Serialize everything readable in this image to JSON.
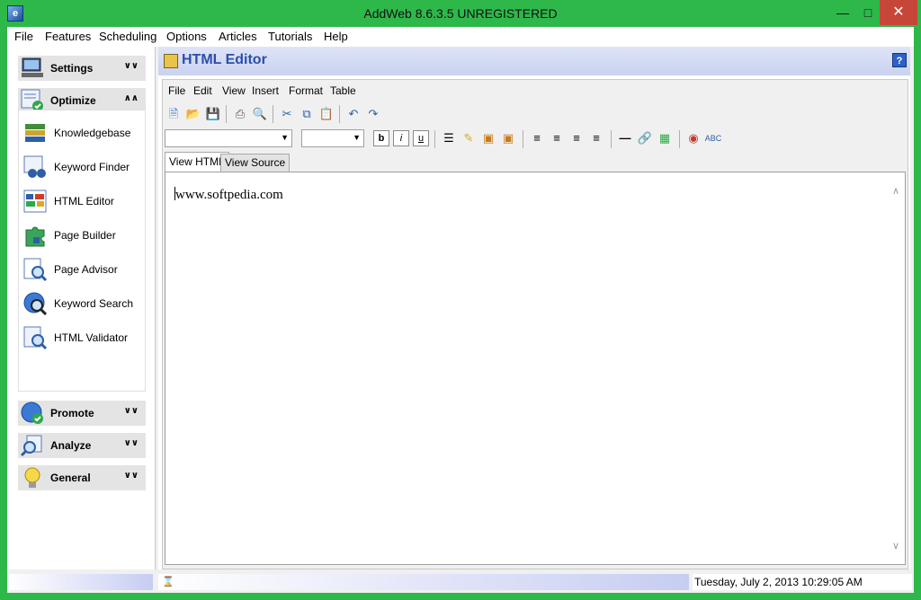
{
  "window": {
    "title": "AddWeb 8.6.3.5  UNREGISTERED",
    "app_icon": "addweb-logo-icon"
  },
  "menu": {
    "items": [
      "File",
      "Features",
      "Scheduling",
      "Options",
      "Articles",
      "Tutorials",
      "Help"
    ]
  },
  "sidebar": {
    "sections": [
      {
        "label": "Settings",
        "icon": "computer-icon",
        "state": "collapsed"
      },
      {
        "label": "Optimize",
        "icon": "optimize-check-icon",
        "state": "expanded"
      },
      {
        "label": "Promote",
        "icon": "globe-check-icon",
        "state": "collapsed"
      },
      {
        "label": "Analyze",
        "icon": "analyze-magnifier-icon",
        "state": "collapsed"
      },
      {
        "label": "General",
        "icon": "lightbulb-icon",
        "state": "collapsed"
      }
    ],
    "optimize_items": [
      {
        "label": "Knowledgebase",
        "icon": "books-icon"
      },
      {
        "label": "Keyword Finder",
        "icon": "binoculars-icon"
      },
      {
        "label": "HTML Editor",
        "icon": "html-editor-icon"
      },
      {
        "label": "Page Builder",
        "icon": "puzzle-icon"
      },
      {
        "label": "Page Advisor",
        "icon": "page-magnifier-icon"
      },
      {
        "label": "Keyword Search",
        "icon": "globe-magnifier-icon"
      },
      {
        "label": "HTML Validator",
        "icon": "validator-magnifier-icon"
      }
    ]
  },
  "panel": {
    "title": "HTML Editor",
    "help": "?"
  },
  "editor": {
    "menu": [
      "File",
      "Edit",
      "View",
      "Insert",
      "Format",
      "Table"
    ],
    "format_buttons": {
      "bold": "b",
      "italic": "i",
      "underline": "u"
    },
    "tabs": [
      "View HTML",
      "View Source"
    ],
    "active_tab": "View HTML",
    "content": "www.softpedia.com"
  },
  "status": {
    "datetime": "Tuesday, July 2, 2013 10:29:05 AM"
  },
  "colors": {
    "frame": "#2eb84a",
    "header_text": "#2c4fa8",
    "close_button": "#c7463a"
  }
}
